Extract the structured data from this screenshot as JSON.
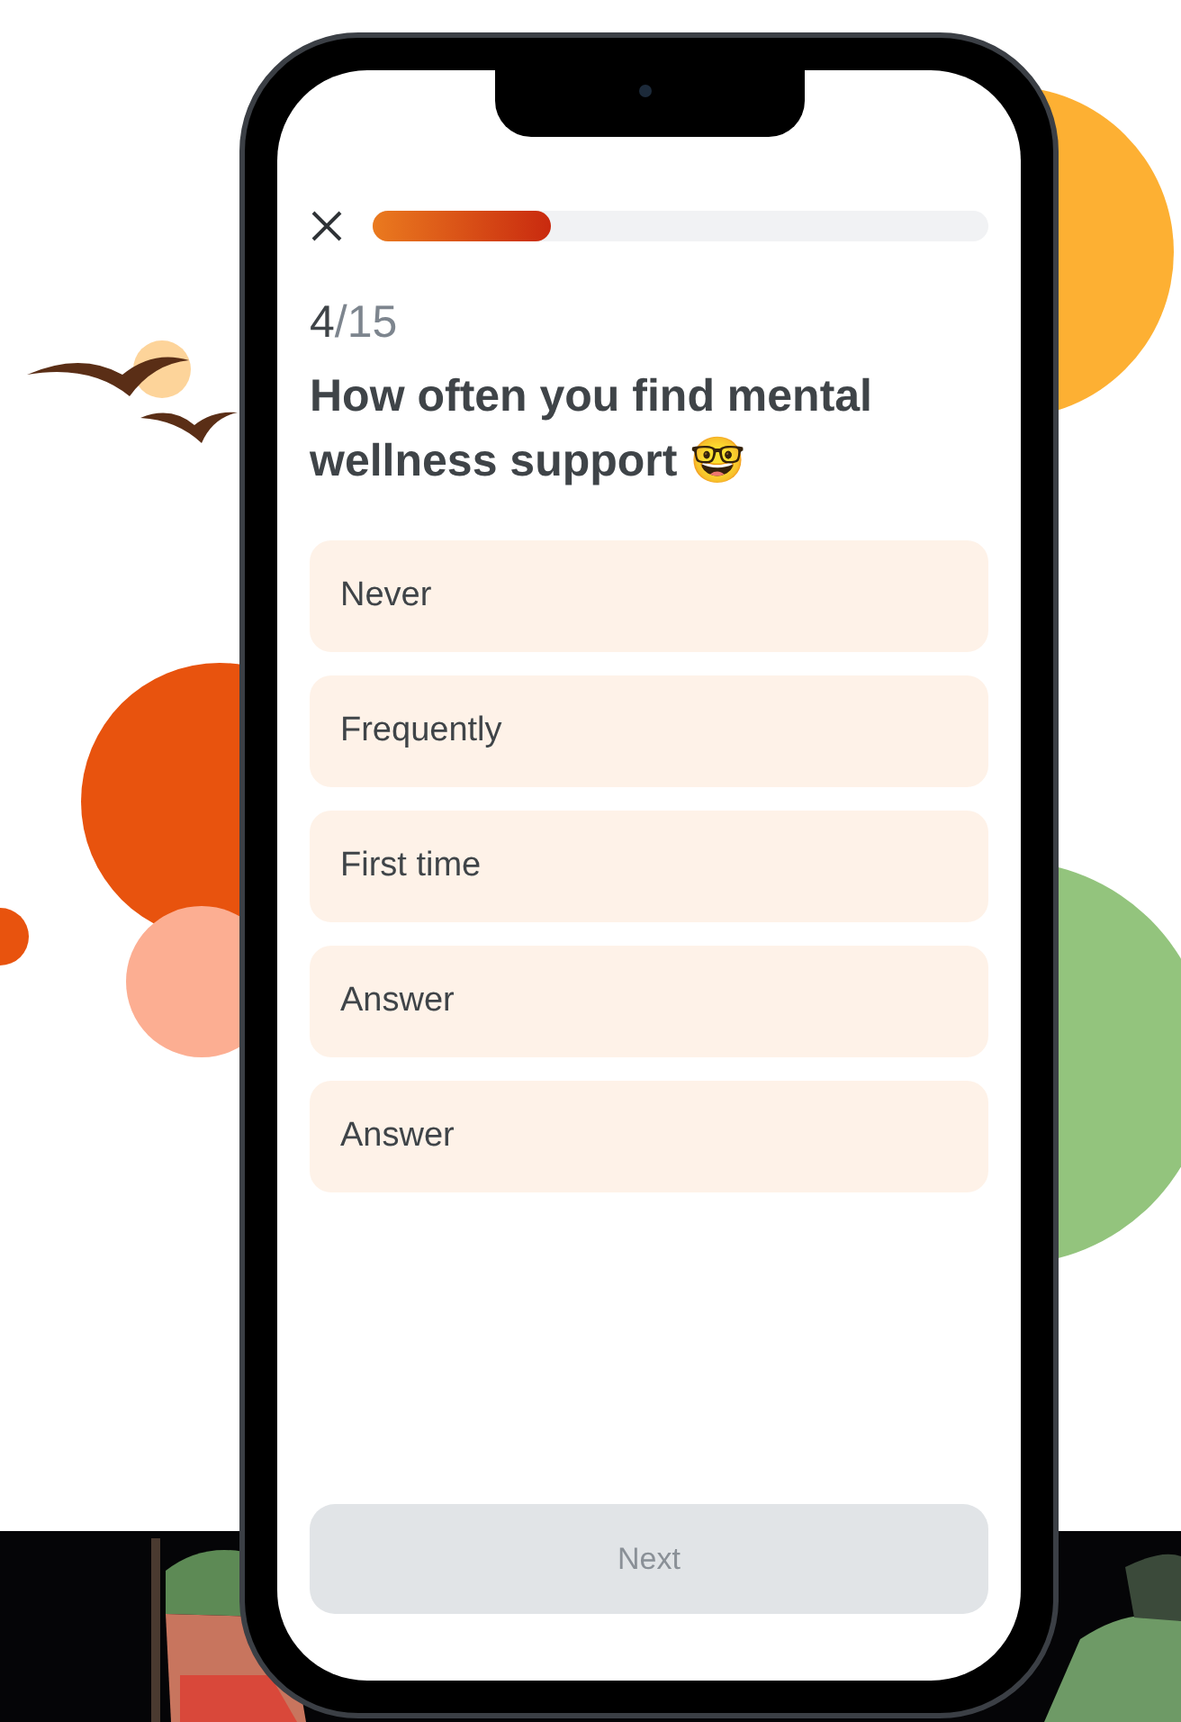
{
  "quiz": {
    "progress": {
      "level": 0.29
    },
    "step": {
      "current": "4",
      "total": "/15"
    },
    "question": "How often you find mental wellness support 🤓",
    "options": [
      {
        "label": "Never",
        "selected": false
      },
      {
        "label": "Frequently",
        "selected": false
      },
      {
        "label": "First time",
        "selected": false
      },
      {
        "label": "Answer",
        "selected": false
      },
      {
        "label": "Answer",
        "selected": false
      }
    ],
    "next_button": {
      "label": "Next",
      "disabled": true
    }
  }
}
